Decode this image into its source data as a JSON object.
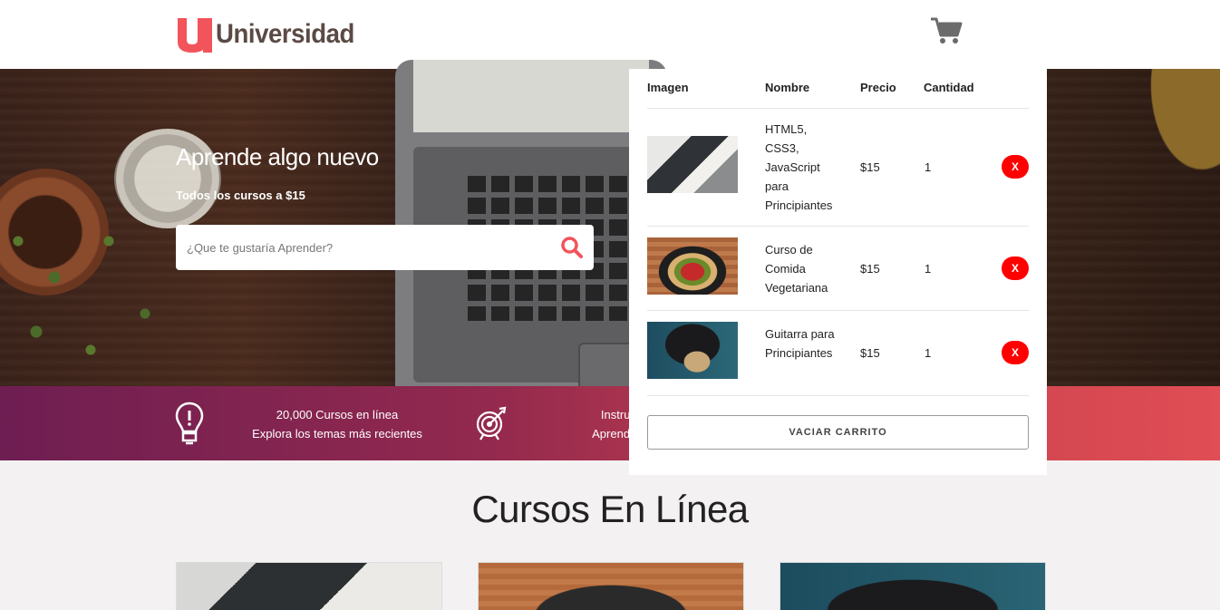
{
  "header": {
    "logo_text": "Universidad",
    "cart_icon": "shopping-cart-icon"
  },
  "hero": {
    "title": "Aprende algo nuevo",
    "subtitle": "Todos los cursos a $15",
    "search_placeholder": "¿Que te gustaría Aprender?",
    "search_icon": "search-icon"
  },
  "bar": {
    "item1_line1": "20,000 Cursos en línea",
    "item1_line2": "Explora los temas más recientes",
    "item2_line1": "Instructor",
    "item2_line2": "Aprende con"
  },
  "section": {
    "title": "Cursos En Línea"
  },
  "cart": {
    "headers": [
      "Imagen",
      "Nombre",
      "Precio",
      "Cantidad"
    ],
    "items": [
      {
        "name": "HTML5, CSS3, JavaScript para Principiantes",
        "price": "$15",
        "qty": "1",
        "remove": "X"
      },
      {
        "name": "Curso de Comida Vegetariana",
        "price": "$15",
        "qty": "1",
        "remove": "X"
      },
      {
        "name": "Guitarra para Principiantes",
        "price": "$15",
        "qty": "1",
        "remove": "X"
      }
    ],
    "empty_label": "VACIAR CARRITO"
  },
  "colors": {
    "brand_red": "#f2545b",
    "logo_brown": "#5b4a44",
    "remove_red": "#ff0000",
    "bar_start": "#6e1e52",
    "bar_end": "#e04d54"
  }
}
